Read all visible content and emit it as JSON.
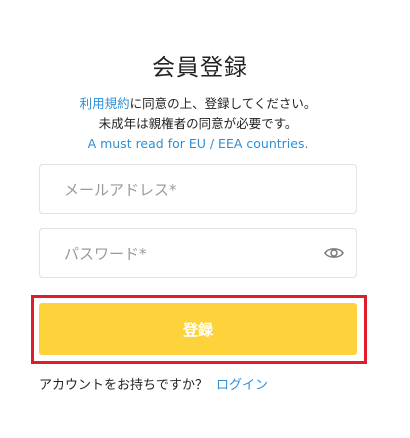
{
  "form": {
    "title": "会員登録",
    "terms_link": "利用規約",
    "terms_rest": "に同意の上、登録してください。",
    "minor_notice": "未成年は親権者の同意が必要です。",
    "eu_link": "A must read for EU / EEA countries.",
    "email_placeholder": "メールアドレス*",
    "email_value": "",
    "password_placeholder": "パスワード*",
    "password_value": "",
    "password_toggle_icon": "eye-icon",
    "submit_label": "登録",
    "footer_text": "アカウントをお持ちですか？",
    "login_link": "ログイン"
  },
  "colors": {
    "accent_button": "#fdd23a",
    "link": "#2d8fd6",
    "highlight_border": "#e01c2a"
  }
}
